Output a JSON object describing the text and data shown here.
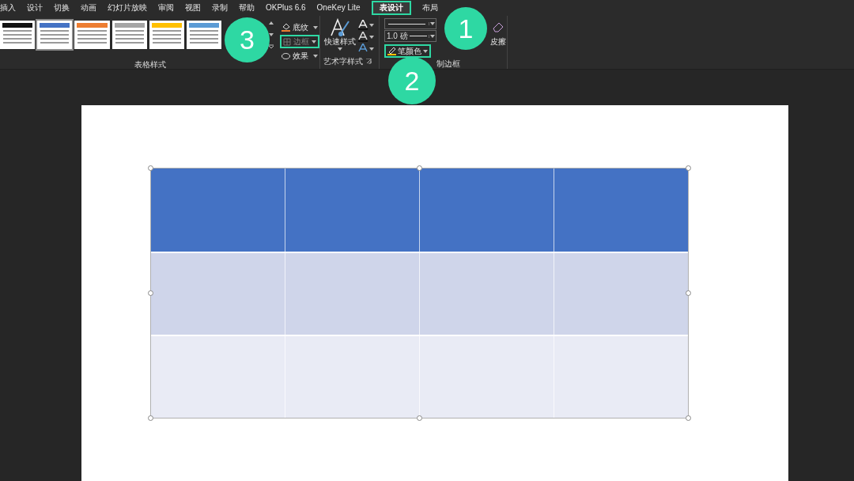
{
  "tabs": [
    {
      "label": "插入",
      "selected": false,
      "highlighted": false
    },
    {
      "label": "设计",
      "selected": false,
      "highlighted": false
    },
    {
      "label": "切换",
      "selected": false,
      "highlighted": false
    },
    {
      "label": "动画",
      "selected": false,
      "highlighted": false
    },
    {
      "label": "幻灯片放映",
      "selected": false,
      "highlighted": false
    },
    {
      "label": "审阅",
      "selected": false,
      "highlighted": false
    },
    {
      "label": "视图",
      "selected": false,
      "highlighted": false
    },
    {
      "label": "录制",
      "selected": false,
      "highlighted": false
    },
    {
      "label": "帮助",
      "selected": false,
      "highlighted": false
    },
    {
      "label": "OKPlus 6.6",
      "selected": false,
      "highlighted": false
    },
    {
      "label": "OneKey Lite",
      "selected": false,
      "highlighted": false
    },
    {
      "label": "表设计",
      "selected": true,
      "highlighted": true
    },
    {
      "label": "布局",
      "selected": false,
      "highlighted": false
    }
  ],
  "table_styles": {
    "label": "表格样式",
    "gallery": [
      {
        "color": "#111111",
        "selected": false
      },
      {
        "color": "#4472c4",
        "selected": true
      },
      {
        "color": "#ed7d31",
        "selected": false
      },
      {
        "color": "#a5a5a5",
        "selected": false
      },
      {
        "color": "#ffc000",
        "selected": false
      },
      {
        "color": "#5b9bd5",
        "selected": false
      }
    ],
    "buttons": [
      {
        "label": "底纹",
        "disabled": false,
        "highlighted": false,
        "kind": "shading"
      },
      {
        "label": "边框",
        "disabled": true,
        "highlighted": true,
        "kind": "border"
      },
      {
        "label": "效果",
        "disabled": false,
        "highlighted": false,
        "kind": "effects"
      }
    ]
  },
  "wordart_styles": {
    "label": "艺术字样式",
    "quick_styles": "快速样式"
  },
  "draw_borders": {
    "label": "制边框",
    "pen_weight": "1.0 磅",
    "pen_color": {
      "label": "笔颜色",
      "highlighted": true
    },
    "eraser": "皮擦"
  },
  "table": {
    "rows": [
      {
        "kind": "header"
      },
      {
        "kind": "band"
      },
      {
        "kind": "plain"
      }
    ]
  },
  "badges": [
    {
      "number": "1"
    },
    {
      "number": "2"
    },
    {
      "number": "3"
    }
  ]
}
